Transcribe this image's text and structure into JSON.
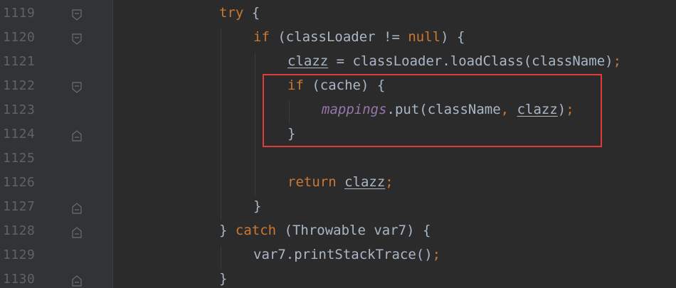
{
  "editor": {
    "lines": [
      {
        "number": "1119",
        "fold": "open",
        "indent": 0,
        "tokens": [
          {
            "t": "try",
            "c": "kw"
          },
          {
            "t": " {",
            "c": "pn"
          }
        ]
      },
      {
        "number": "1120",
        "fold": "open",
        "indent": 1,
        "tokens": [
          {
            "t": "if",
            "c": "kw"
          },
          {
            "t": " (classLoader != ",
            "c": "pn"
          },
          {
            "t": "null",
            "c": "kw"
          },
          {
            "t": ") {",
            "c": "pn"
          }
        ]
      },
      {
        "number": "1121",
        "fold": "none",
        "indent": 2,
        "tokens": [
          {
            "t": "clazz",
            "c": "pn ul"
          },
          {
            "t": " = classLoader.loadClass(className)",
            "c": "pn"
          },
          {
            "t": ";",
            "c": "kw"
          }
        ]
      },
      {
        "number": "1122",
        "fold": "open",
        "indent": 2,
        "tokens": [
          {
            "t": "if",
            "c": "kw"
          },
          {
            "t": " (cache) {",
            "c": "pn"
          }
        ]
      },
      {
        "number": "1123",
        "fold": "none",
        "indent": 3,
        "tokens": [
          {
            "t": "mappings",
            "c": "fld"
          },
          {
            "t": ".put(className",
            "c": "pn"
          },
          {
            "t": ",",
            "c": "kw"
          },
          {
            "t": " ",
            "c": "pn"
          },
          {
            "t": "clazz",
            "c": "pn ul"
          },
          {
            "t": ")",
            "c": "pn"
          },
          {
            "t": ";",
            "c": "kw"
          }
        ]
      },
      {
        "number": "1124",
        "fold": "close",
        "indent": 2,
        "tokens": [
          {
            "t": "}",
            "c": "pn"
          }
        ]
      },
      {
        "number": "1125",
        "fold": "none",
        "indent": 2,
        "tokens": []
      },
      {
        "number": "1126",
        "fold": "none",
        "indent": 2,
        "tokens": [
          {
            "t": "return",
            "c": "kw"
          },
          {
            "t": " ",
            "c": "pn"
          },
          {
            "t": "clazz",
            "c": "pn ul"
          },
          {
            "t": ";",
            "c": "kw"
          }
        ]
      },
      {
        "number": "1127",
        "fold": "close",
        "indent": 1,
        "tokens": [
          {
            "t": "}",
            "c": "pn"
          }
        ]
      },
      {
        "number": "1128",
        "fold": "close",
        "indent": 0,
        "tokens": [
          {
            "t": "}",
            "c": "pn"
          },
          {
            "t": " catch",
            "c": "kw"
          },
          {
            "t": " (Throwable var7) {",
            "c": "pn"
          }
        ]
      },
      {
        "number": "1129",
        "fold": "none",
        "indent": 1,
        "tokens": [
          {
            "t": "var7.printStackTrace()",
            "c": "pn"
          },
          {
            "t": ";",
            "c": "kw"
          }
        ]
      },
      {
        "number": "1130",
        "fold": "close",
        "indent": 0,
        "tokens": [
          {
            "t": "}",
            "c": "pn"
          }
        ]
      }
    ]
  },
  "colors": {
    "background": "#2b2b2b",
    "gutter": "#313335",
    "keyword": "#cc7832",
    "text": "#a9b7c6",
    "field": "#9876aa",
    "line_number": "#606366",
    "highlight_border": "#e03c3c"
  }
}
